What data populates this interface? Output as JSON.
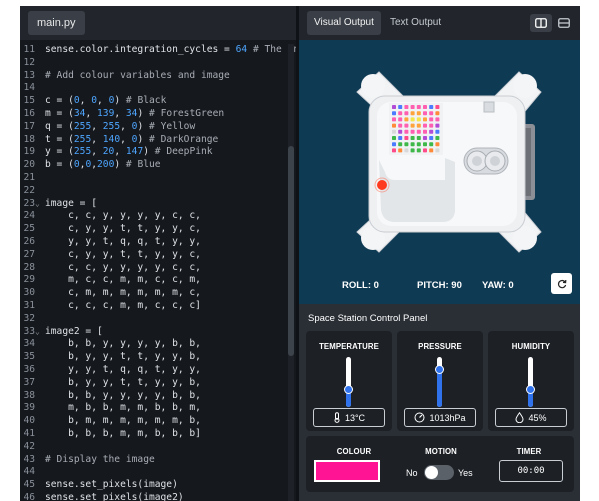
{
  "editor": {
    "file_tab": "main.py",
    "lines": [
      {
        "n": "11",
        "fold": "",
        "parts": [
          [
            "sense.color.integration_cycles = ",
            "t"
          ],
          [
            "64",
            "num"
          ],
          [
            " # The int",
            "cmt"
          ]
        ]
      },
      {
        "n": "12",
        "fold": "",
        "parts": []
      },
      {
        "n": "13",
        "fold": "",
        "parts": [
          [
            "# Add colour variables and image",
            "cmt"
          ]
        ]
      },
      {
        "n": "14",
        "fold": "",
        "parts": []
      },
      {
        "n": "15",
        "fold": "",
        "parts": [
          [
            "c = (",
            "t"
          ],
          [
            "0",
            "num"
          ],
          [
            ", ",
            "t"
          ],
          [
            "0",
            "num"
          ],
          [
            ", ",
            "t"
          ],
          [
            "0",
            "num"
          ],
          [
            ") ",
            "t"
          ],
          [
            "# Black",
            "cmt"
          ]
        ]
      },
      {
        "n": "16",
        "fold": "",
        "parts": [
          [
            "m = (",
            "t"
          ],
          [
            "34",
            "num"
          ],
          [
            ", ",
            "t"
          ],
          [
            "139",
            "num"
          ],
          [
            ", ",
            "t"
          ],
          [
            "34",
            "num"
          ],
          [
            ") ",
            "t"
          ],
          [
            "# ForestGreen",
            "cmt"
          ]
        ]
      },
      {
        "n": "17",
        "fold": "",
        "parts": [
          [
            "q = (",
            "t"
          ],
          [
            "255",
            "num"
          ],
          [
            ", ",
            "t"
          ],
          [
            "255",
            "num"
          ],
          [
            ", ",
            "t"
          ],
          [
            "0",
            "num"
          ],
          [
            ") ",
            "t"
          ],
          [
            "# Yellow",
            "cmt"
          ]
        ]
      },
      {
        "n": "18",
        "fold": "",
        "parts": [
          [
            "t = (",
            "t"
          ],
          [
            "255",
            "num"
          ],
          [
            ", ",
            "t"
          ],
          [
            "140",
            "num"
          ],
          [
            ", ",
            "t"
          ],
          [
            "0",
            "num"
          ],
          [
            ") ",
            "t"
          ],
          [
            "# DarkOrange",
            "cmt"
          ]
        ]
      },
      {
        "n": "19",
        "fold": "",
        "parts": [
          [
            "y = (",
            "t"
          ],
          [
            "255",
            "num"
          ],
          [
            ", ",
            "t"
          ],
          [
            "20",
            "num"
          ],
          [
            ", ",
            "t"
          ],
          [
            "147",
            "num"
          ],
          [
            ") ",
            "t"
          ],
          [
            "# DeepPink",
            "cmt"
          ]
        ]
      },
      {
        "n": "20",
        "fold": "",
        "parts": [
          [
            "b = (",
            "t"
          ],
          [
            "0",
            "num"
          ],
          [
            ",",
            "t"
          ],
          [
            "0",
            "num"
          ],
          [
            ",",
            "t"
          ],
          [
            "200",
            "num"
          ],
          [
            ") ",
            "t"
          ],
          [
            "# Blue",
            "cmt"
          ]
        ]
      },
      {
        "n": "21",
        "fold": "",
        "parts": []
      },
      {
        "n": "22",
        "fold": "",
        "parts": []
      },
      {
        "n": "23",
        "fold": "⌄",
        "parts": [
          [
            "image = [",
            "t"
          ]
        ]
      },
      {
        "n": "24",
        "fold": "",
        "parts": [
          [
            "    c, c, y, y, y, y, c, c,",
            "t"
          ]
        ]
      },
      {
        "n": "25",
        "fold": "",
        "parts": [
          [
            "    c, y, y, t, t, y, y, c,",
            "t"
          ]
        ]
      },
      {
        "n": "26",
        "fold": "",
        "parts": [
          [
            "    y, y, t, q, q, t, y, y,",
            "t"
          ]
        ]
      },
      {
        "n": "27",
        "fold": "",
        "parts": [
          [
            "    c, y, y, t, t, y, y, c,",
            "t"
          ]
        ]
      },
      {
        "n": "28",
        "fold": "",
        "parts": [
          [
            "    c, c, y, y, y, y, c, c,",
            "t"
          ]
        ]
      },
      {
        "n": "29",
        "fold": "",
        "parts": [
          [
            "    m, c, c, m, m, c, c, m,",
            "t"
          ]
        ]
      },
      {
        "n": "30",
        "fold": "",
        "parts": [
          [
            "    c, m, m, m, m, m, m, c,",
            "t"
          ]
        ]
      },
      {
        "n": "31",
        "fold": "",
        "parts": [
          [
            "    c, c, c, m, m, c, c, c]",
            "t"
          ]
        ]
      },
      {
        "n": "32",
        "fold": "",
        "parts": []
      },
      {
        "n": "33",
        "fold": "⌄",
        "parts": [
          [
            "image2 = [",
            "t"
          ]
        ]
      },
      {
        "n": "34",
        "fold": "",
        "parts": [
          [
            "    b, b, y, y, y, y, b, b,",
            "t"
          ]
        ]
      },
      {
        "n": "35",
        "fold": "",
        "parts": [
          [
            "    b, y, y, t, t, y, y, b,",
            "t"
          ]
        ]
      },
      {
        "n": "36",
        "fold": "",
        "parts": [
          [
            "    y, y, t, q, q, t, y, y,",
            "t"
          ]
        ]
      },
      {
        "n": "37",
        "fold": "",
        "parts": [
          [
            "    b, y, y, t, t, y, y, b,",
            "t"
          ]
        ]
      },
      {
        "n": "38",
        "fold": "",
        "parts": [
          [
            "    b, b, y, y, y, y, b, b,",
            "t"
          ]
        ]
      },
      {
        "n": "39",
        "fold": "",
        "parts": [
          [
            "    m, b, b, m, m, b, b, m,",
            "t"
          ]
        ]
      },
      {
        "n": "40",
        "fold": "",
        "parts": [
          [
            "    b, m, m, m, m, m, m, b,",
            "t"
          ]
        ]
      },
      {
        "n": "41",
        "fold": "",
        "parts": [
          [
            "    b, b, b, m, m, b, b, b]",
            "t"
          ]
        ]
      },
      {
        "n": "42",
        "fold": "",
        "parts": []
      },
      {
        "n": "43",
        "fold": "",
        "parts": [
          [
            "# Display the image",
            "cmt"
          ]
        ]
      },
      {
        "n": "44",
        "fold": "",
        "parts": []
      },
      {
        "n": "45",
        "fold": "",
        "parts": [
          [
            "sense.set_pixels(image)",
            "t"
          ]
        ]
      },
      {
        "n": "46",
        "fold": "",
        "parts": [
          [
            "sense.set_pixels(image2)",
            "t"
          ]
        ]
      }
    ]
  },
  "output": {
    "tabs": [
      "Visual Output",
      "Text Output"
    ],
    "active_tab": "Visual Output",
    "readouts": {
      "roll": "ROLL: 0",
      "pitch": "PITCH: 90",
      "yaw": "YAW: 0"
    }
  },
  "panel": {
    "title": "Space Station Control Panel",
    "temperature": {
      "label": "TEMPERATURE",
      "value": "13°C",
      "level": 0.35
    },
    "pressure": {
      "label": "PRESSURE",
      "value": "1013hPa",
      "level": 0.75
    },
    "humidity": {
      "label": "HUMIDITY",
      "value": "45%",
      "level": 0.35
    },
    "colour": {
      "label": "COLOUR",
      "value": "#ff1493"
    },
    "motion": {
      "label": "MOTION",
      "no": "No",
      "yes": "Yes",
      "on": false
    },
    "timer": {
      "label": "TIMER",
      "value": "00:00"
    }
  },
  "led_matrix": [
    "c,c,y,y,y,y,c,c",
    "c,y,y,t,t,y,y,c",
    "y,y,t,q,q,t,y,y",
    "c,y,y,t,t,y,y,c",
    "c,c,y,y,y,y,c,c",
    "m,c,c,m,m,c,c,m",
    "c,m,m,m,m,m,m,c",
    "c,c,c,m,m,c,c,c"
  ]
}
